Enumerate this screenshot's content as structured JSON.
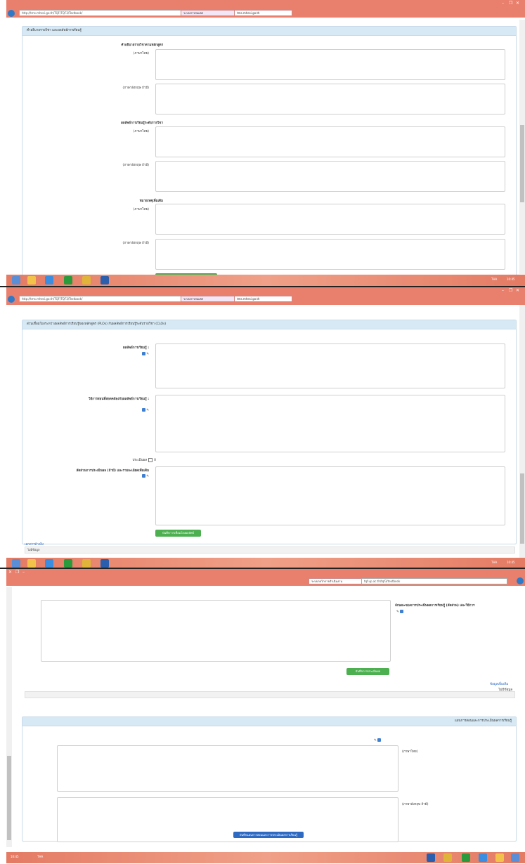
{
  "browser": {
    "url1": "http://tms.mhesi.go.th/TQF/TQF3/Textbook/",
    "url2": "http://tms.mhesi.go.th/TQF/TQF3/Textbook/",
    "url3": "tqf.up.ac.th/tqf3/textbook",
    "tab_label": "ระบบสารสนเทศ",
    "tab2_label": "tms.mhesi.go.th",
    "tab3_label": "ระบบกลไกการดำเนินงาน",
    "minimize": "–",
    "restore": "❐",
    "close": "✕"
  },
  "panel1": {
    "section_title": "คำอธิบายรายวิชา และผลลัพธ์การเรียนรู้",
    "group1_title": "คำอธิบายรายวิชาตามหลักสูตร",
    "group2_title": "ผลลัพธ์การเรียนรู้ระดับรายวิชา",
    "group3_title": "หมายเหตุเพิ่มเติม",
    "thai_label": "(ภาษาไทย)",
    "eng_label": "(ภาษาอังกฤษ ถ้ามี)",
    "save_button": "บันทึกคำอธิบายรายวิชาและผลลัพธ์การเรียนรู้"
  },
  "panel2": {
    "section_title": "ส่วนเชื่อมโยงระหว่างผลลัพธ์การเรียนรู้ของหลักสูตร (PLOs) กับผลลัพธ์การเรียนรู้ระดับรายวิชา (CLOs)",
    "field1_label": "ผลลัพธ์การเรียนรู้ :",
    "field2_label": "วิธีการสอนที่สอดคล้องกับผลลัพธ์การเรียนรู้ :",
    "check_label": "ประเมินผล",
    "check_value": "0",
    "field3_label": "สัดส่วนการประเมินผล (ถ้ามี) และรายละเอียดเพิ่มเติม",
    "save_button": "บันทึกการเชื่อมโยงผลลัพธ์",
    "sub_link": "เอกสารอ้างอิง",
    "sub_value": "ไม่มีข้อมูล"
  },
  "panel3": {
    "right_label": "ลักษณะของการประเมินผลการเรียนรู้ (สัดส่วน) และวิธีการ",
    "save_button": "บันทึกการประเมินผล",
    "link_label": "ข้อมูลเพิ่มเติม",
    "link_value": "ไม่มีข้อมูล",
    "section_title": "แผนการสอนและการประเมินผลการเรียนรู้",
    "thai_label": "(ภาษาไทย)",
    "eng_label": "(ภาษาอังกฤษ ถ้ามี)",
    "save_button2": "บันทึกแผนการสอนและการประเมินผลการเรียนรู้",
    "small_check": "ประเมินผล"
  },
  "taskbar": {
    "time": "10:45",
    "lang": "THA"
  }
}
